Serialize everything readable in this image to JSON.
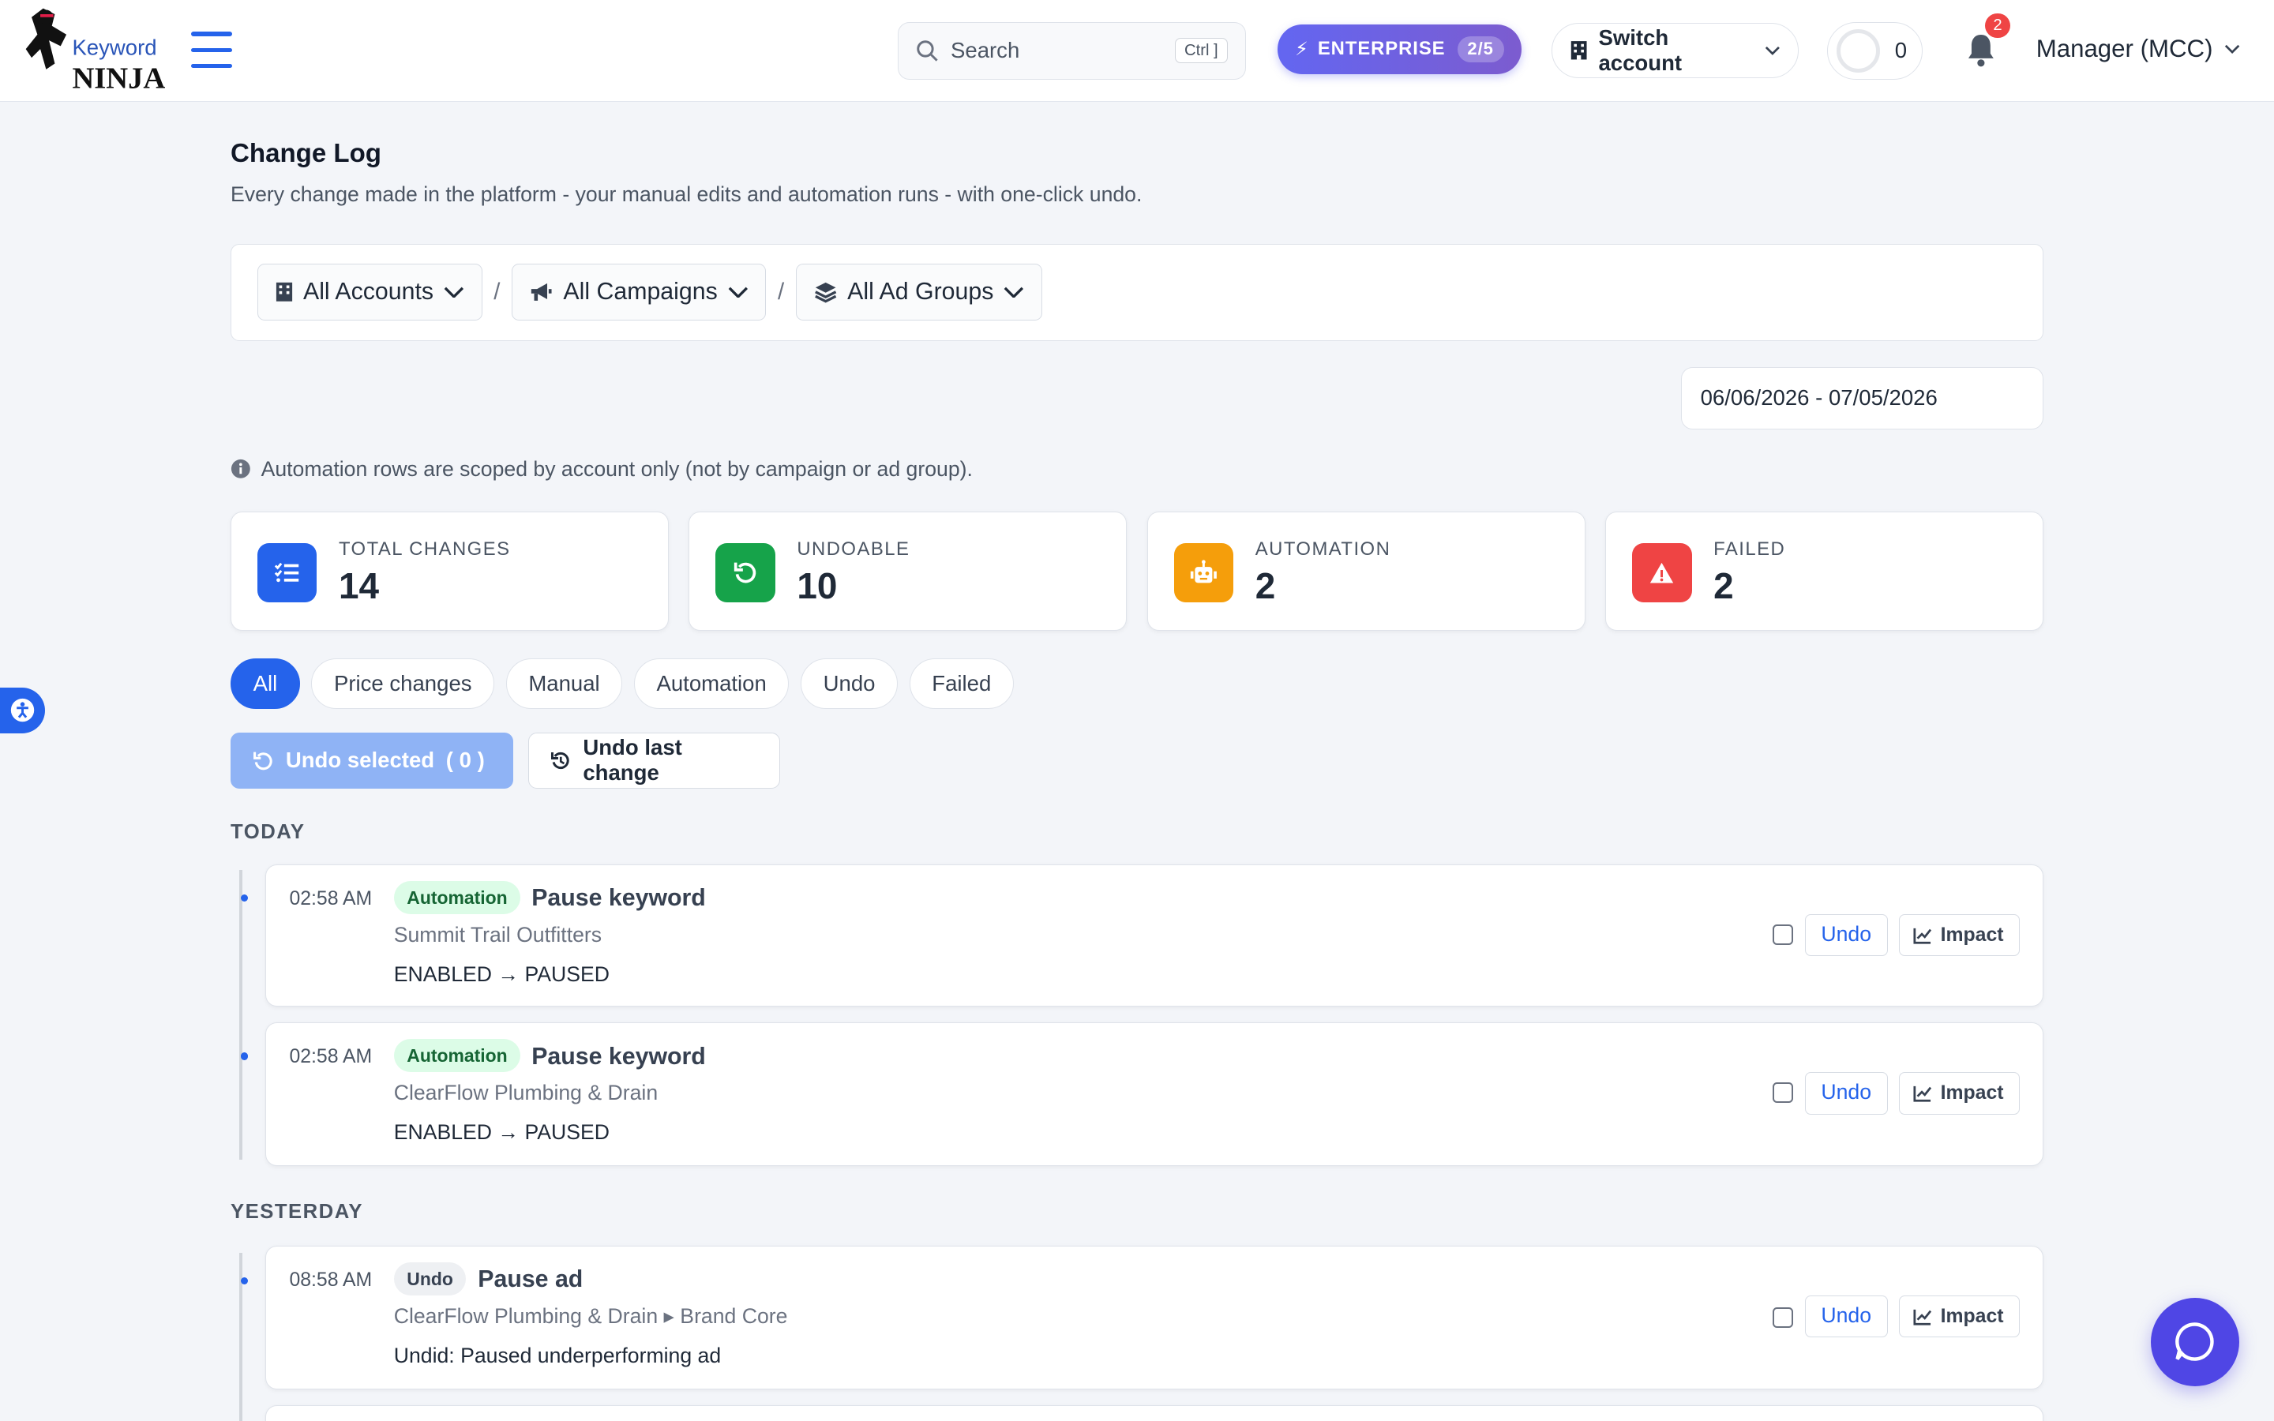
{
  "header": {
    "logo_top": "Keyword",
    "logo_bottom": "NINJA",
    "search_placeholder": "Search",
    "search_shortcut": "Ctrl ]",
    "plan_label": "ENTERPRISE",
    "plan_usage": "2/5",
    "switch_account": "Switch account",
    "counter": "0",
    "notification_count": "2",
    "user_menu": "Manager (MCC)"
  },
  "page": {
    "title": "Change Log",
    "subtitle": "Every change made in the platform - your manual edits and automation runs - with one-click undo."
  },
  "filters": {
    "accounts": "All Accounts",
    "campaigns": "All Campaigns",
    "ad_groups": "All Ad Groups",
    "separator": "/"
  },
  "date_range": "06/06/2026 - 07/05/2026",
  "scope_note": "Automation rows are scoped by account only (not by campaign or ad group).",
  "stats": [
    {
      "label": "TOTAL CHANGES",
      "value": "14",
      "color": "#2563eb",
      "icon": "list-check-icon"
    },
    {
      "label": "UNDOABLE",
      "value": "10",
      "color": "#16a34a",
      "icon": "undo-icon"
    },
    {
      "label": "AUTOMATION",
      "value": "2",
      "color": "#f59e0b",
      "icon": "robot-icon"
    },
    {
      "label": "FAILED",
      "value": "2",
      "color": "#ef4444",
      "icon": "warning-icon"
    }
  ],
  "tabs": [
    {
      "label": "All",
      "active": true
    },
    {
      "label": " Price changes"
    },
    {
      "label": "Manual"
    },
    {
      "label": "Automation"
    },
    {
      "label": "Undo"
    },
    {
      "label": "Failed"
    }
  ],
  "actions": {
    "undo_selected": "Undo selected",
    "undo_selected_count": "( 0 )",
    "undo_last": "Undo last change"
  },
  "groups": [
    {
      "label": "TODAY",
      "entries": [
        {
          "time": "02:58 AM",
          "badge": "Automation",
          "title": "Pause keyword",
          "sub": "Summit Trail Outfitters",
          "desc": "ENABLED → PAUSED",
          "undo": "Undo",
          "impact": "Impact"
        },
        {
          "time": "02:58 AM",
          "badge": "Automation",
          "title": "Pause keyword",
          "sub": "ClearFlow Plumbing & Drain",
          "desc": "ENABLED → PAUSED",
          "undo": "Undo",
          "impact": "Impact"
        }
      ]
    },
    {
      "label": "YESTERDAY",
      "entries": [
        {
          "time": "08:58 AM",
          "badge": "Undo",
          "title": "Pause ad",
          "sub": "ClearFlow Plumbing & Drain ▸ Brand Core",
          "desc": "Undid: Paused underperforming ad",
          "undo": "Undo",
          "impact": "Impact"
        }
      ]
    }
  ]
}
